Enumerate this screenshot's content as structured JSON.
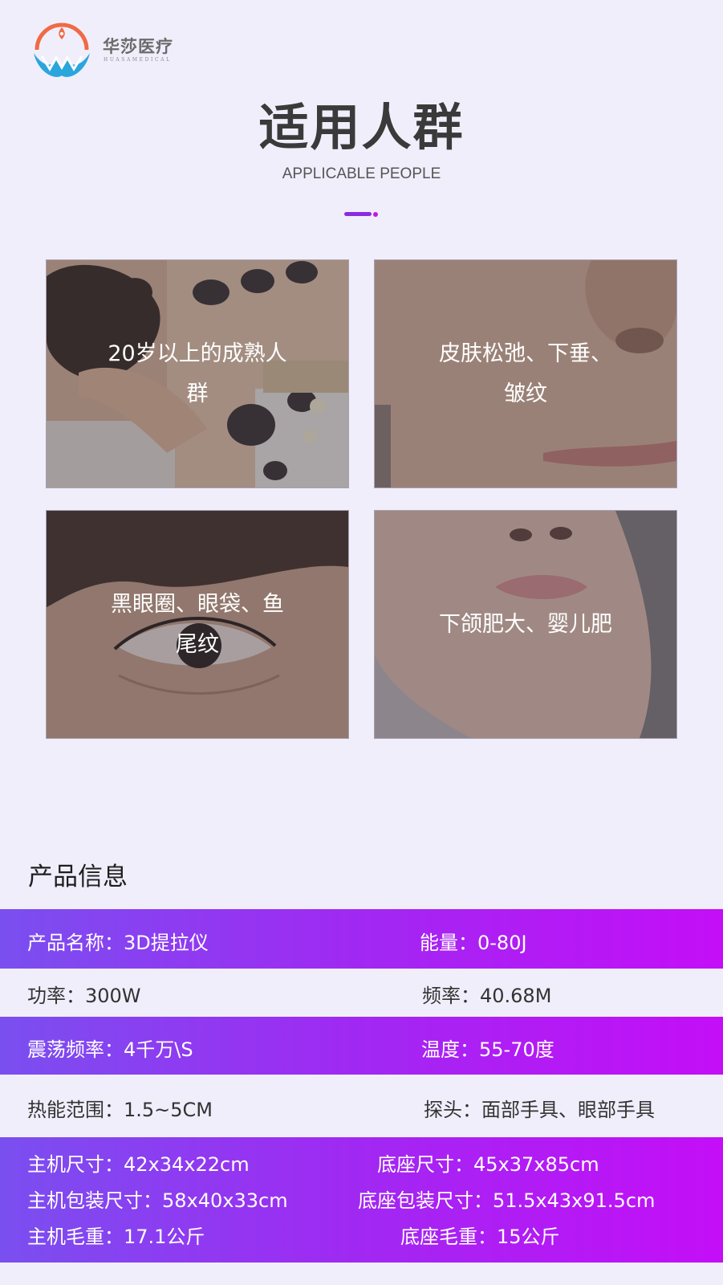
{
  "brand": {
    "name_cn": "华莎医疗",
    "name_en": "HUASAMEDICAL",
    "colors": {
      "orange": "#f06a45",
      "blue": "#2aa6dc"
    },
    "logo_icon": "hw-logo-icon"
  },
  "header": {
    "title": "适用人群",
    "subtitle": "APPLICABLE PEOPLE",
    "accent": "#8a2be2"
  },
  "cards": [
    {
      "caption": "20岁以上的成熟人群",
      "image": "spa-back-massage-photo"
    },
    {
      "caption": "皮肤松弛、下垂、皱纹",
      "image": "nose-skin-closeup-photo"
    },
    {
      "caption": "黑眼圈、眼袋、鱼尾纹",
      "image": "eye-closeup-photo"
    },
    {
      "caption": "下颌肥大、婴儿肥",
      "image": "chin-lips-closeup-photo"
    }
  ],
  "product": {
    "section_title": "产品信息",
    "gradient": [
      "#7a4ff0",
      "#c40ef7"
    ],
    "specs": [
      {
        "left": "产品名称：3D提拉仪",
        "right": "能量：0-80J"
      },
      {
        "left": "功率：300W",
        "right": "频率：40.68M"
      },
      {
        "left": "震荡频率：4千万\\S",
        "right": "温度：55-70度"
      },
      {
        "left": "热能范围：1.5~5CM",
        "right": "探头：面部手具、眼部手具"
      },
      {
        "left": "主机尺寸：42x34x22cm",
        "right": "底座尺寸：45x37x85cm"
      },
      {
        "left": "主机包装尺寸：58x40x33cm",
        "right": "底座包装尺寸：51.5x43x91.5cm"
      },
      {
        "left": "主机毛重：17.1公斤",
        "right": "底座毛重：15公斤"
      }
    ]
  }
}
